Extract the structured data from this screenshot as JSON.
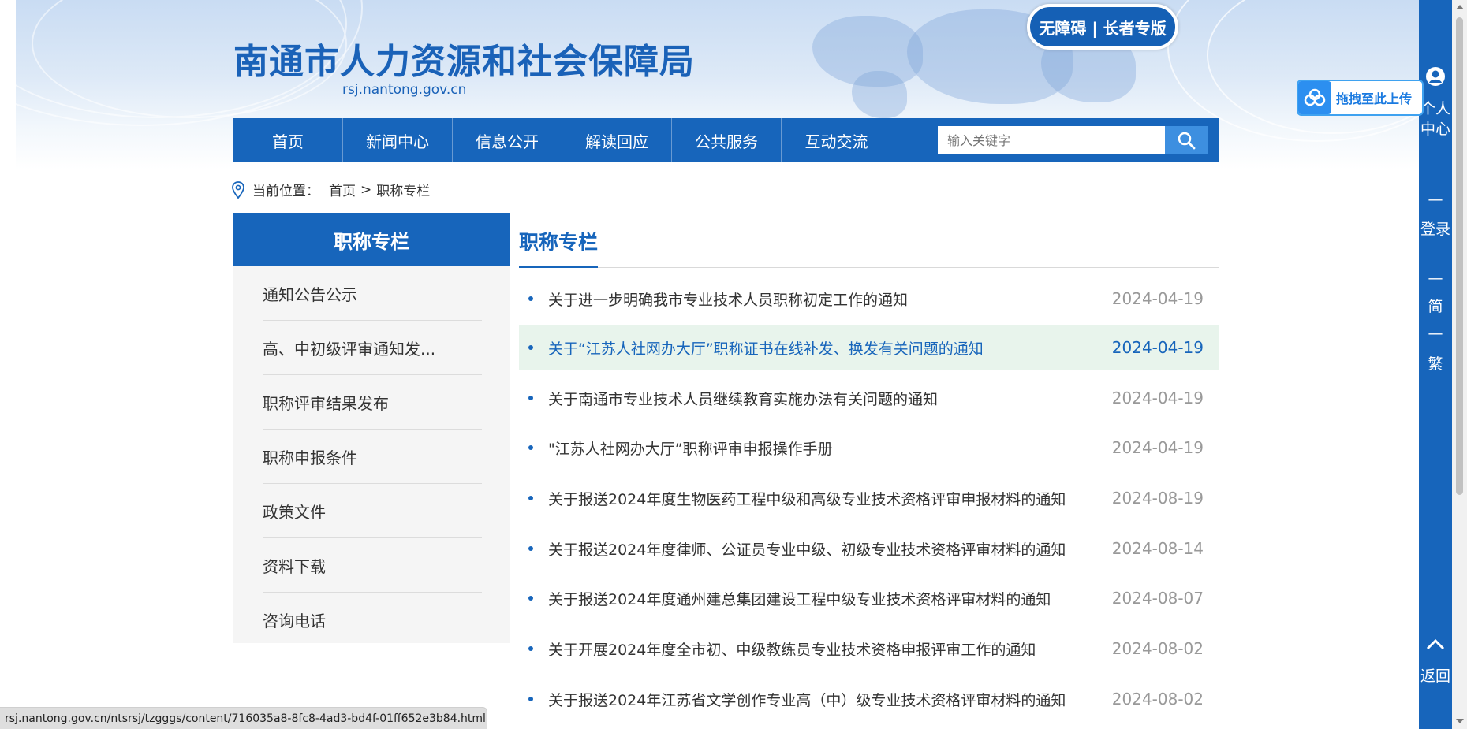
{
  "header": {
    "site_title": "南通市人力资源和社会保障局",
    "site_domain": "rsj.nantong.gov.cn",
    "accessibility_label": "无障碍 | 长者专版"
  },
  "nav": {
    "items": [
      "首页",
      "新闻中心",
      "信息公开",
      "解读回应",
      "公共服务",
      "互动交流"
    ],
    "search_placeholder": "输入关键字"
  },
  "breadcrumb": {
    "prefix": "当前位置：",
    "home": "首页",
    "separator": ">",
    "current": "职称专栏"
  },
  "sidebar": {
    "title": "职称专栏",
    "items": [
      "通知公告公示",
      "高、中初级评审通知发...",
      "职称评审结果发布",
      "职称申报条件",
      "政策文件",
      "资料下载",
      "咨询电话"
    ]
  },
  "main": {
    "title": "职称专栏",
    "articles": [
      {
        "title": "关于进一步明确我市专业技术人员职称初定工作的通知",
        "date": "2024-04-19"
      },
      {
        "title": "关于“江苏人社网办大厅”职称证书在线补发、换发有关问题的通知",
        "date": "2024-04-19"
      },
      {
        "title": "关于南通市专业技术人员继续教育实施办法有关问题的通知",
        "date": "2024-04-19"
      },
      {
        "title": "\"江苏人社网办大厅”职称评审申报操作手册",
        "date": "2024-04-19"
      },
      {
        "title": "关于报送2024年度生物医药工程中级和高级专业技术资格评审申报材料的通知",
        "date": "2024-08-19"
      },
      {
        "title": "关于报送2024年度律师、公证员专业中级、初级专业技术资格评审材料的通知",
        "date": "2024-08-14"
      },
      {
        "title": "关于报送2024年度通州建总集团建设工程中级专业技术资格评审材料的通知",
        "date": "2024-08-07"
      },
      {
        "title": "关于开展2024年度全市初、中级教练员专业技术资格申报评审工作的通知",
        "date": "2024-08-02"
      },
      {
        "title": "关于报送2024年江苏省文学创作专业高（中）级专业技术资格评审材料的通知",
        "date": "2024-08-02"
      }
    ],
    "highlighted_index": 1
  },
  "right_bar": {
    "personal_center": "个人中心",
    "login": "登录",
    "simplified": "简",
    "traditional": "繁",
    "back_top": "返回",
    "dash": "—"
  },
  "upload_widget": {
    "label": "拖拽至此上传"
  },
  "status_bar": {
    "url": "rsj.nantong.gov.cn/ntsrsj/tzgggs/content/716035a8-8fc8-4ad3-bd4f-01ff652e3b84.html"
  },
  "colors": {
    "primary": "#1765bb",
    "highlight_row": "#e8f4ec",
    "date_gray": "#999999"
  },
  "icons": [
    "location-pin-icon",
    "search-icon",
    "user-icon",
    "chevron-up-icon",
    "cloud-upload-icon"
  ]
}
